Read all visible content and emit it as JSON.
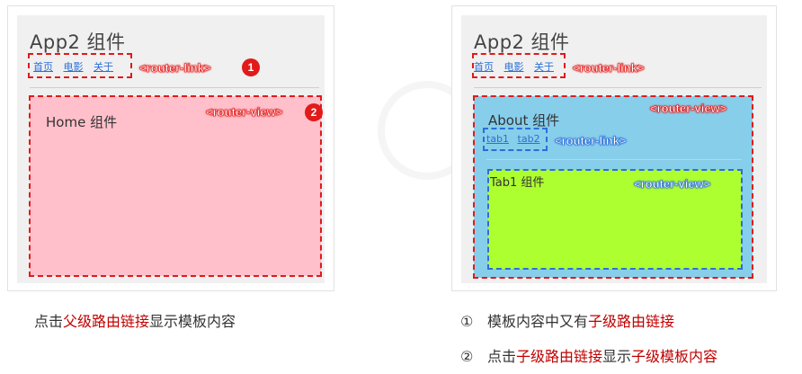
{
  "left": {
    "app_title": "App2 组件",
    "nav_links": [
      "首页",
      "电影",
      "关于"
    ],
    "router_link_tag": "<router-link>",
    "router_view_tag": "<router-view>",
    "badge1": "1",
    "badge2": "2",
    "view_title": "Home 组件"
  },
  "right": {
    "app_title": "App2 组件",
    "nav_links": [
      "首页",
      "电影",
      "关于"
    ],
    "router_link_tag": "<router-link>",
    "router_view_tag": "<router-view>",
    "view_title": "About 组件",
    "tab_links": [
      "tab1",
      "tab2"
    ],
    "tab_router_link_tag": "<router-link>",
    "tab_router_view_tag": "<router-view>",
    "tab_title": "Tab1 组件"
  },
  "captions": {
    "left": [
      "点击",
      "父级路由链接",
      "显示模板内容"
    ],
    "right1_num": "①",
    "right1": [
      "模板内容中又有",
      "子级路由链接"
    ],
    "right2_num": "②",
    "right2": [
      "点击",
      "子级路由链接",
      "显示",
      "子级模板内容"
    ]
  },
  "colors": {
    "dashed_red": "#e11a1a",
    "dashed_blue": "#2a6fd8",
    "home_bg": "#ffc0cb",
    "about_bg": "#87ceeb",
    "tab_bg": "#adff2f",
    "highlight": "#c00000"
  }
}
